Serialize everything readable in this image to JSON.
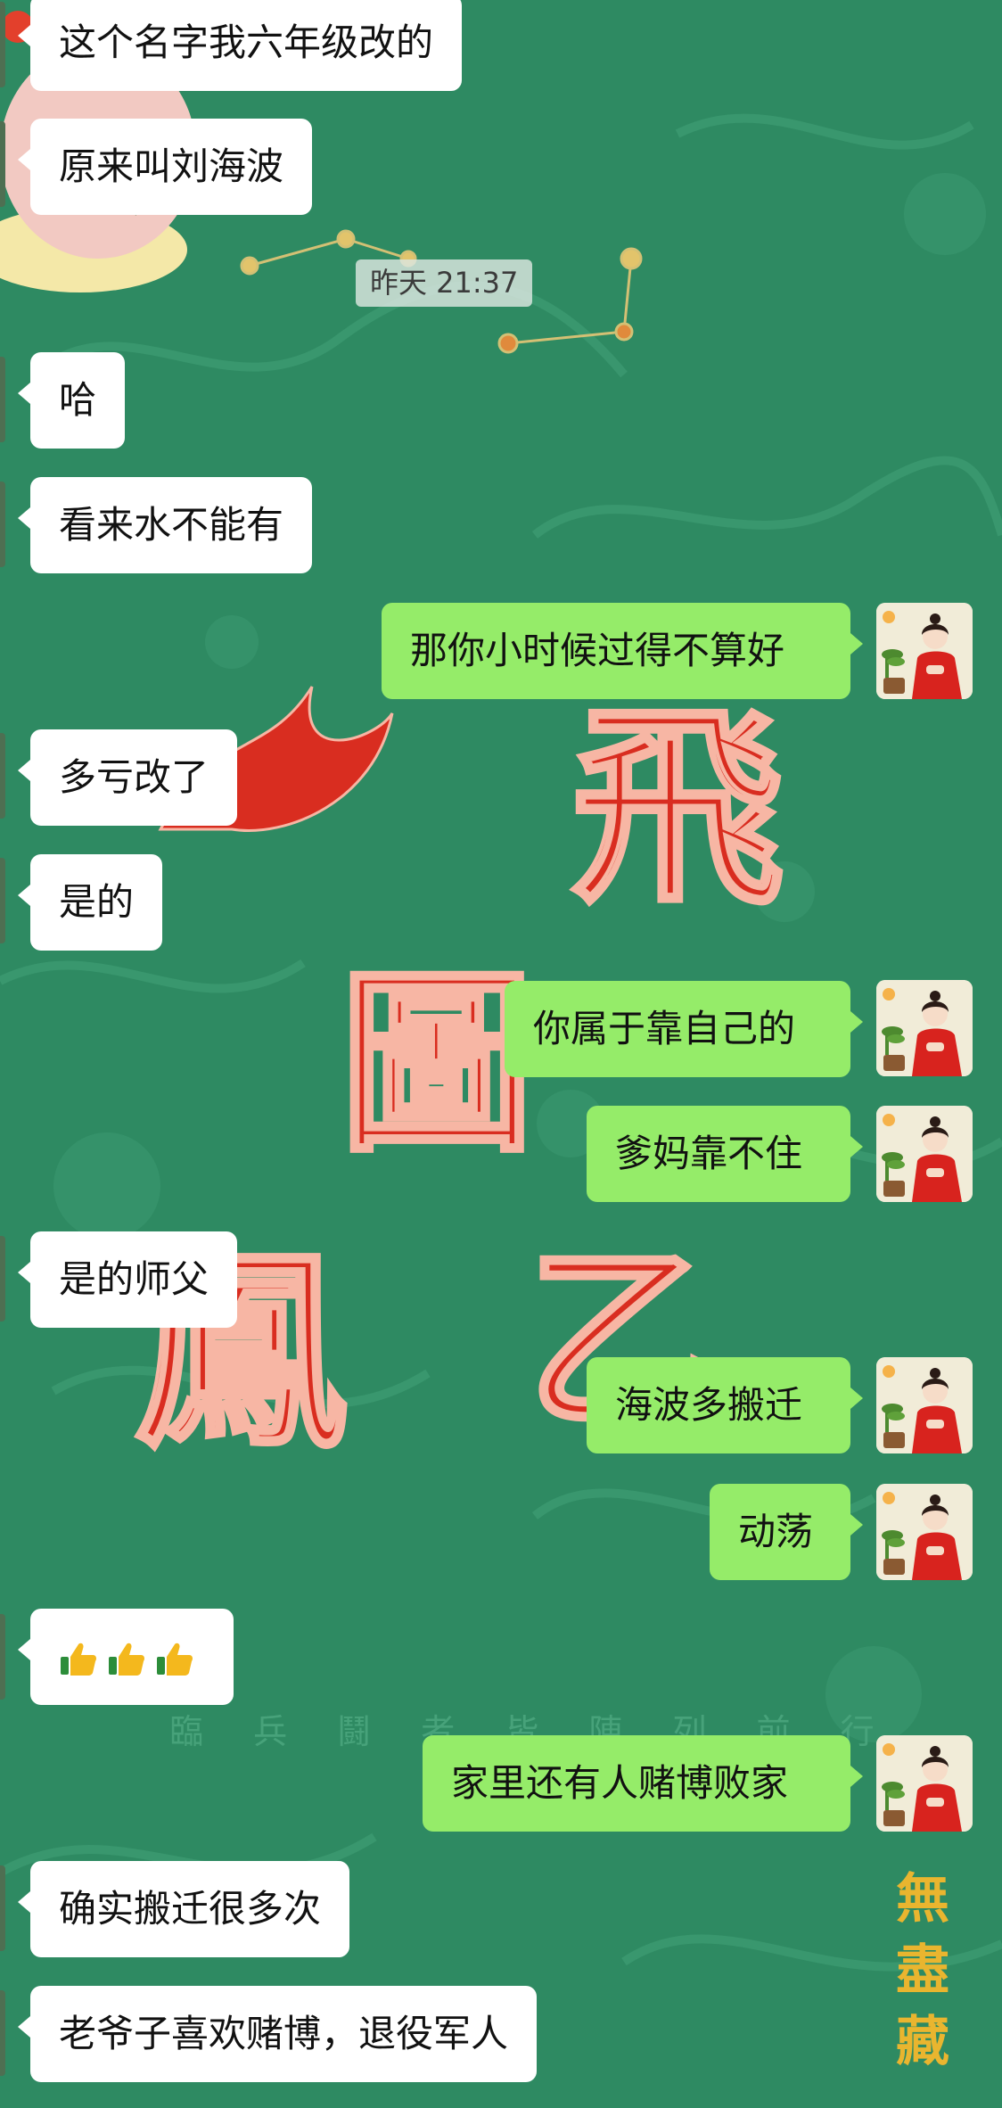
{
  "chat": {
    "timestamp": "昨天 21:37",
    "messages": [
      {
        "id": "m1",
        "side": "in",
        "text": "这个名字我六年级改的"
      },
      {
        "id": "m2",
        "side": "in",
        "text": "原来叫刘海波"
      },
      {
        "id": "m3",
        "side": "in",
        "text": "哈"
      },
      {
        "id": "m4",
        "side": "in",
        "text": "看来水不能有"
      },
      {
        "id": "m5",
        "side": "out",
        "text": "那你小时候过得不算好"
      },
      {
        "id": "m6",
        "side": "in",
        "text": "多亏改了"
      },
      {
        "id": "m7",
        "side": "in",
        "text": "是的"
      },
      {
        "id": "m8",
        "side": "out",
        "text": "你属于靠自己的"
      },
      {
        "id": "m9",
        "side": "out",
        "text": "爹妈靠不住"
      },
      {
        "id": "m10",
        "side": "in",
        "text": "是的师父"
      },
      {
        "id": "m11",
        "side": "out",
        "text": "海波多搬迁"
      },
      {
        "id": "m12",
        "side": "out",
        "text": "动荡"
      },
      {
        "id": "m13",
        "side": "in",
        "text": "",
        "emoji": [
          "thumbs-up",
          "thumbs-up",
          "thumbs-up"
        ]
      },
      {
        "id": "m14",
        "side": "out",
        "text": "家里还有人赌博败家"
      },
      {
        "id": "m15",
        "side": "in",
        "text": "确实搬迁很多次"
      },
      {
        "id": "m16",
        "side": "in",
        "text": "老爷子喜欢赌博，退役军人"
      }
    ]
  },
  "background": {
    "color": "#2e8a62",
    "decor_glyphs": [
      "飛",
      "圖",
      "鳳",
      "乙",
      "無",
      "盡",
      "藏"
    ],
    "faint_caption": "臨 兵 鬪 者 皆 陣 列 前 行"
  },
  "colors": {
    "incoming_bubble": "#ffffff",
    "outgoing_bubble": "#95ec69",
    "timestamp_bg": "#dce6e0"
  },
  "icons": {
    "avatar": "avatar-woman-red-dress-icon",
    "emoji": "thumbs-up-icon"
  }
}
